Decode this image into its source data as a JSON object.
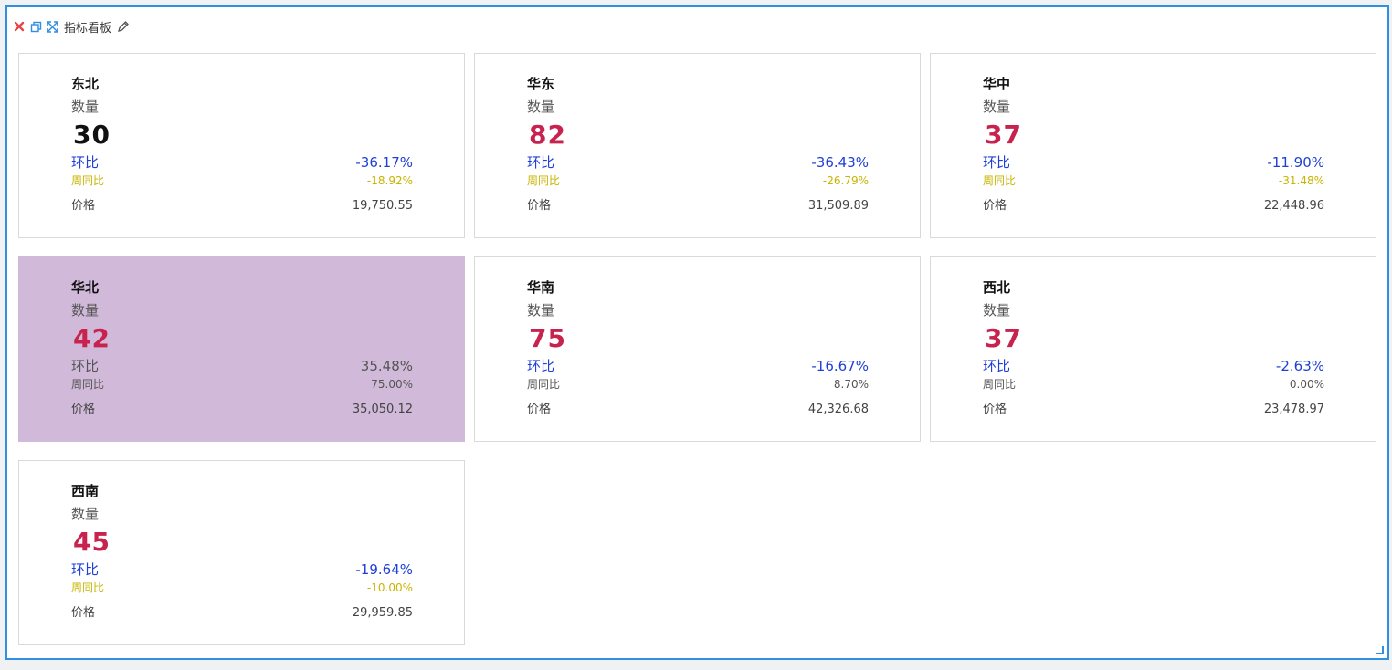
{
  "toolbar": {
    "title": "指标看板",
    "icons": [
      "close-icon",
      "copy-icon",
      "expand-icon",
      "edit-icon"
    ]
  },
  "colors": {
    "accent_border": "#2f8fe0",
    "value_red": "#c8234f",
    "value_black": "#111111",
    "mom_blue": "#1f3fd6",
    "wow_yellow": "#c9b400",
    "neutral_gray": "#555555",
    "highlight_bg": "#d0b9d9"
  },
  "cards": [
    {
      "region": "东北",
      "metric": "数量",
      "value": "30",
      "mom_label": "环比",
      "mom": "-36.17%",
      "wow_label": "周同比",
      "wow": "-18.92%",
      "price_label": "价格",
      "price": "19,750.55",
      "value_color": "#111111",
      "mom_color": "#1f3fd6",
      "wow_color": "#c9b400",
      "bg": "#ffffff"
    },
    {
      "region": "华东",
      "metric": "数量",
      "value": "82",
      "mom_label": "环比",
      "mom": "-36.43%",
      "wow_label": "周同比",
      "wow": "-26.79%",
      "price_label": "价格",
      "price": "31,509.89",
      "value_color": "#c8234f",
      "mom_color": "#1f3fd6",
      "wow_color": "#c9b400",
      "bg": "#ffffff"
    },
    {
      "region": "华中",
      "metric": "数量",
      "value": "37",
      "mom_label": "环比",
      "mom": "-11.90%",
      "wow_label": "周同比",
      "wow": "-31.48%",
      "price_label": "价格",
      "price": "22,448.96",
      "value_color": "#c8234f",
      "mom_color": "#1f3fd6",
      "wow_color": "#c9b400",
      "bg": "#ffffff"
    },
    {
      "region": "华北",
      "metric": "数量",
      "value": "42",
      "mom_label": "环比",
      "mom": "35.48%",
      "wow_label": "周同比",
      "wow": "75.00%",
      "price_label": "价格",
      "price": "35,050.12",
      "value_color": "#c8234f",
      "mom_color": "#555555",
      "wow_color": "#555555",
      "bg": "#d0b9d9"
    },
    {
      "region": "华南",
      "metric": "数量",
      "value": "75",
      "mom_label": "环比",
      "mom": "-16.67%",
      "wow_label": "周同比",
      "wow": "8.70%",
      "price_label": "价格",
      "price": "42,326.68",
      "value_color": "#c8234f",
      "mom_color": "#1f3fd6",
      "wow_color": "#555555",
      "bg": "#ffffff"
    },
    {
      "region": "西北",
      "metric": "数量",
      "value": "37",
      "mom_label": "环比",
      "mom": "-2.63%",
      "wow_label": "周同比",
      "wow": "0.00%",
      "price_label": "价格",
      "price": "23,478.97",
      "value_color": "#c8234f",
      "mom_color": "#1f3fd6",
      "wow_color": "#555555",
      "bg": "#ffffff"
    },
    {
      "region": "西南",
      "metric": "数量",
      "value": "45",
      "mom_label": "环比",
      "mom": "-19.64%",
      "wow_label": "周同比",
      "wow": "-10.00%",
      "price_label": "价格",
      "price": "29,959.85",
      "value_color": "#c8234f",
      "mom_color": "#1f3fd6",
      "wow_color": "#c9b400",
      "bg": "#ffffff"
    }
  ]
}
